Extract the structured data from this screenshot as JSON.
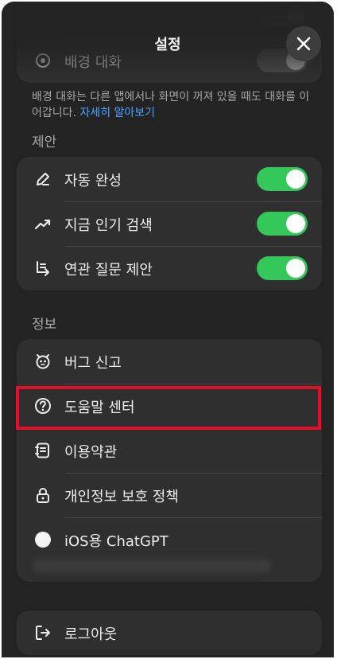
{
  "header": {
    "title": "설정"
  },
  "background_chat": {
    "row_label": "배경 대화",
    "caption": "배경 대화는 다른 앱에서나 화면이 꺼져 있을 때도 대화를 이어갑니다.",
    "learn_more": "자세히 알아보기"
  },
  "suggestions": {
    "header": "제안",
    "items": [
      {
        "label": "자동 완성",
        "enabled": true,
        "icon": "pencil-icon"
      },
      {
        "label": "지금 인기 검색",
        "enabled": true,
        "icon": "trending-icon"
      },
      {
        "label": "연관 질문 제안",
        "enabled": true,
        "icon": "subdirectory-icon"
      }
    ]
  },
  "info": {
    "header": "정보",
    "items": [
      {
        "label": "버그 신고",
        "icon": "bug-icon"
      },
      {
        "label": "도움말 센터",
        "icon": "question-icon"
      },
      {
        "label": "이용약관",
        "icon": "document-icon"
      },
      {
        "label": "개인정보 보호 정책",
        "icon": "lock-icon"
      },
      {
        "label": "iOS용 ChatGPT",
        "icon": "chatgpt-logo-icon"
      }
    ]
  },
  "account": {
    "logout_label": "로그아웃"
  },
  "colors": {
    "sheet_bg": "#232323",
    "group_bg": "#2f2f2f",
    "toggle_on": "#34c759",
    "link": "#4aa3ff",
    "highlight": "#e0102a"
  }
}
